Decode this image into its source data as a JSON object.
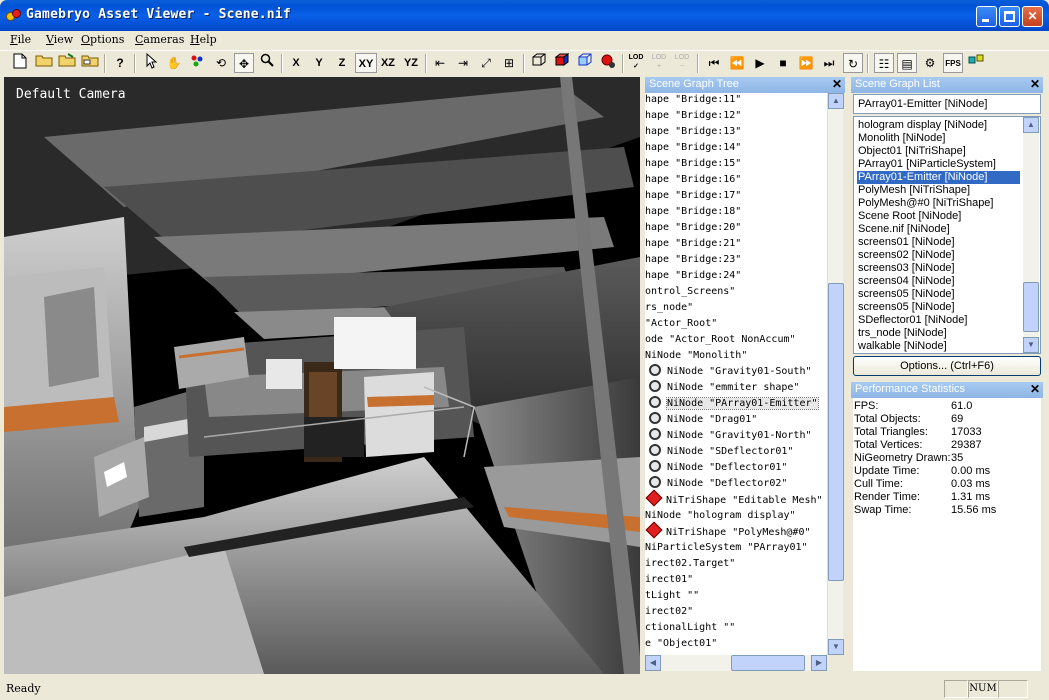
{
  "window": {
    "title": "Gamebryo Asset Viewer - Scene.nif"
  },
  "menu": [
    "File",
    "View",
    "Options",
    "Cameras",
    "Help"
  ],
  "toolbar": {
    "axes": [
      "X",
      "Y",
      "Z",
      "XY",
      "XZ",
      "YZ"
    ],
    "fps_label": "FPS",
    "lod_plus": "LOD",
    "lod_minus": "LOD"
  },
  "viewport": {
    "camera_label": "Default Camera"
  },
  "scene_tree": {
    "title": "Scene Graph Tree",
    "rows": [
      {
        "text": "hape \"Bridge:11\"",
        "icon": "none",
        "indent": 0
      },
      {
        "text": "hape \"Bridge:12\"",
        "icon": "none",
        "indent": 0
      },
      {
        "text": "hape \"Bridge:13\"",
        "icon": "none",
        "indent": 0
      },
      {
        "text": "hape \"Bridge:14\"",
        "icon": "none",
        "indent": 0
      },
      {
        "text": "hape \"Bridge:15\"",
        "icon": "none",
        "indent": 0
      },
      {
        "text": "hape \"Bridge:16\"",
        "icon": "none",
        "indent": 0
      },
      {
        "text": "hape \"Bridge:17\"",
        "icon": "none",
        "indent": 0
      },
      {
        "text": "hape \"Bridge:18\"",
        "icon": "none",
        "indent": 0
      },
      {
        "text": "hape \"Bridge:20\"",
        "icon": "none",
        "indent": 0
      },
      {
        "text": "hape \"Bridge:21\"",
        "icon": "none",
        "indent": 0
      },
      {
        "text": "hape \"Bridge:23\"",
        "icon": "none",
        "indent": 0
      },
      {
        "text": "hape \"Bridge:24\"",
        "icon": "none",
        "indent": 0
      },
      {
        "text": "ontrol_Screens\"",
        "icon": "none",
        "indent": 0
      },
      {
        "text": "rs_node\"",
        "icon": "none",
        "indent": 0
      },
      {
        "text": " \"Actor_Root\"",
        "icon": "none",
        "indent": 0
      },
      {
        "text": "ode \"Actor_Root NonAccum\"",
        "icon": "none",
        "indent": 0
      },
      {
        "text": " NiNode \"Monolith\"",
        "icon": "none",
        "indent": 0
      },
      {
        "text": "NiNode \"Gravity01-South\"",
        "icon": "node",
        "indent": 1
      },
      {
        "text": "NiNode \"emmiter shape\"",
        "icon": "node",
        "indent": 1
      },
      {
        "text": "NiNode \"PArray01-Emitter\"",
        "icon": "node",
        "indent": 1,
        "selected": true
      },
      {
        "text": "NiNode \"Drag01\"",
        "icon": "node",
        "indent": 1
      },
      {
        "text": "NiNode \"Gravity01-North\"",
        "icon": "node",
        "indent": 1
      },
      {
        "text": "NiNode \"SDeflector01\"",
        "icon": "node",
        "indent": 1
      },
      {
        "text": "NiNode \"Deflector01\"",
        "icon": "node",
        "indent": 1
      },
      {
        "text": "NiNode \"Deflector02\"",
        "icon": "node",
        "indent": 1
      },
      {
        "text": "NiTriShape \"Editable Mesh\"",
        "icon": "shape",
        "indent": 1
      },
      {
        "text": "NiNode \"hologram display\"",
        "icon": "none",
        "indent": 0
      },
      {
        "text": "NiTriShape \"PolyMesh@#0\"",
        "icon": "shape",
        "indent": 1
      },
      {
        "text": "NiParticleSystem \"PArray01\"",
        "icon": "none",
        "indent": 0
      },
      {
        "text": "irect02.Target\"",
        "icon": "none",
        "indent": 0
      },
      {
        "text": "irect01\"",
        "icon": "none",
        "indent": 0
      },
      {
        "text": "tLight \"\"",
        "icon": "none",
        "indent": 0
      },
      {
        "text": "irect02\"",
        "icon": "none",
        "indent": 0
      },
      {
        "text": "ctionalLight \"\"",
        "icon": "none",
        "indent": 0
      },
      {
        "text": "e \"Object01\"",
        "icon": "none",
        "indent": 0
      }
    ]
  },
  "scene_list": {
    "title": "Scene Graph List",
    "selected": "PArray01-Emitter [NiNode]",
    "items": [
      "hologram display [NiNode]",
      "Monolith [NiNode]",
      "Object01 [NiTriShape]",
      "PArray01 [NiParticleSystem]",
      "PArray01-Emitter [NiNode]",
      "PolyMesh [NiTriShape]",
      "PolyMesh@#0 [NiTriShape]",
      "Scene Root [NiNode]",
      "Scene.nif [NiNode]",
      "screens01 [NiNode]",
      "screens02 [NiNode]",
      "screens03 [NiNode]",
      "screens04 [NiNode]",
      "screens05 [NiNode]",
      "screens05 [NiNode]",
      "SDeflector01 [NiNode]",
      "trs_node [NiNode]",
      "walkable [NiNode]"
    ],
    "options_label": "Options... (Ctrl+F6)"
  },
  "perf": {
    "title": "Performance Statistics",
    "rows": [
      {
        "label": "FPS:",
        "value": "61.0"
      },
      {
        "label": "Total Objects:",
        "value": "69"
      },
      {
        "label": "Total Triangles:",
        "value": "17033"
      },
      {
        "label": "Total Vertices:",
        "value": "29387"
      },
      {
        "label": "NiGeometry Drawn:",
        "value": "35"
      },
      {
        "label": "Update Time:",
        "value": "0.00 ms"
      },
      {
        "label": "Cull Time:",
        "value": "0.03 ms"
      },
      {
        "label": "Render Time:",
        "value": "1.31 ms"
      },
      {
        "label": "Swap Time:",
        "value": "15.56 ms"
      }
    ]
  },
  "status": {
    "text": "Ready",
    "num": "NUM"
  }
}
